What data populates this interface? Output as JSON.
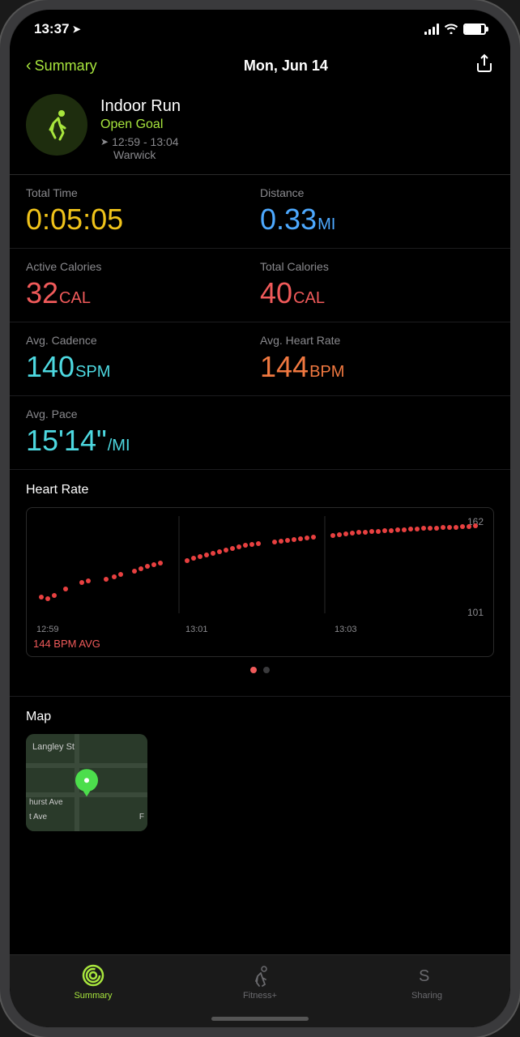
{
  "statusBar": {
    "time": "13:37",
    "locationArrow": "➤"
  },
  "header": {
    "back_label": "Summary",
    "title": "Mon, Jun 14",
    "share_icon": "share"
  },
  "workout": {
    "type": "Indoor Run",
    "goal": "Open Goal",
    "time_range": "12:59 - 13:04",
    "location": "Warwick"
  },
  "stats": {
    "total_time_label": "Total Time",
    "total_time_value": "0:05:05",
    "distance_label": "Distance",
    "distance_value": "0.33",
    "distance_unit": "MI",
    "active_cal_label": "Active Calories",
    "active_cal_value": "32",
    "active_cal_unit": "CAL",
    "total_cal_label": "Total Calories",
    "total_cal_value": "40",
    "total_cal_unit": "CAL",
    "cadence_label": "Avg. Cadence",
    "cadence_value": "140",
    "cadence_unit": "SPM",
    "heart_rate_label": "Avg. Heart Rate",
    "heart_rate_value": "144",
    "heart_rate_unit": "BPM",
    "pace_label": "Avg. Pace",
    "pace_value": "15'14\"",
    "pace_unit": "/MI"
  },
  "heartRateChart": {
    "title": "Heart Rate",
    "max_label": "162",
    "min_label": "101",
    "x_labels": [
      "12:59",
      "13:01",
      "13:03",
      ""
    ],
    "avg_label": "144 BPM AVG"
  },
  "map": {
    "title": "Map",
    "label_street": "Langley St",
    "label_left": "hurst Ave",
    "label_bottom": "t Ave",
    "label_right": "F"
  },
  "tabBar": {
    "summary_label": "Summary",
    "fitness_label": "Fitness+",
    "sharing_label": "Sharing"
  }
}
